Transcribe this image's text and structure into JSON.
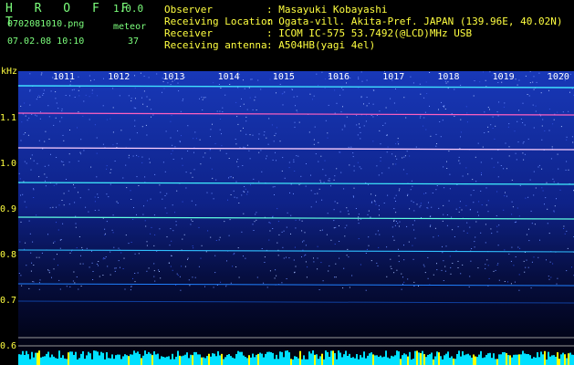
{
  "header": {
    "app_title": "H R O F F T",
    "version": "1.0.0",
    "filename": "0702081010.png",
    "meteor_label": "meteor",
    "datetime": "07.02.08 10:10",
    "meteor_count": "37"
  },
  "info": {
    "observer_label": "Observer",
    "observer": "Masayuki Kobayashi",
    "location_label": "Receiving Location",
    "location": "Ogata-vill. Akita-Pref. JAPAN (139.96E, 40.02N)",
    "receiver_label": "Receiver",
    "receiver": "ICOM IC-575 53.7492(@LCD)MHz USB",
    "antenna_label": "Receiving antenna",
    "antenna": "A504HB(yagi 4el)"
  },
  "axis": {
    "unit": "kHz",
    "y_ticks": [
      "1.1",
      "1.0",
      "0.9",
      "0.8",
      "0.7",
      "0.6"
    ],
    "time_ticks": [
      "1011",
      "1012",
      "1013",
      "1014",
      "1015",
      "1016",
      "1017",
      "1018",
      "1019",
      "1020"
    ]
  },
  "colors": {
    "header_green": "#7CFF7C",
    "header_yellow": "#FFFF40",
    "background_blue": "#102A9A",
    "signal_cyan": "#00E0FF",
    "marker_yellow": "#FFFF00"
  }
}
